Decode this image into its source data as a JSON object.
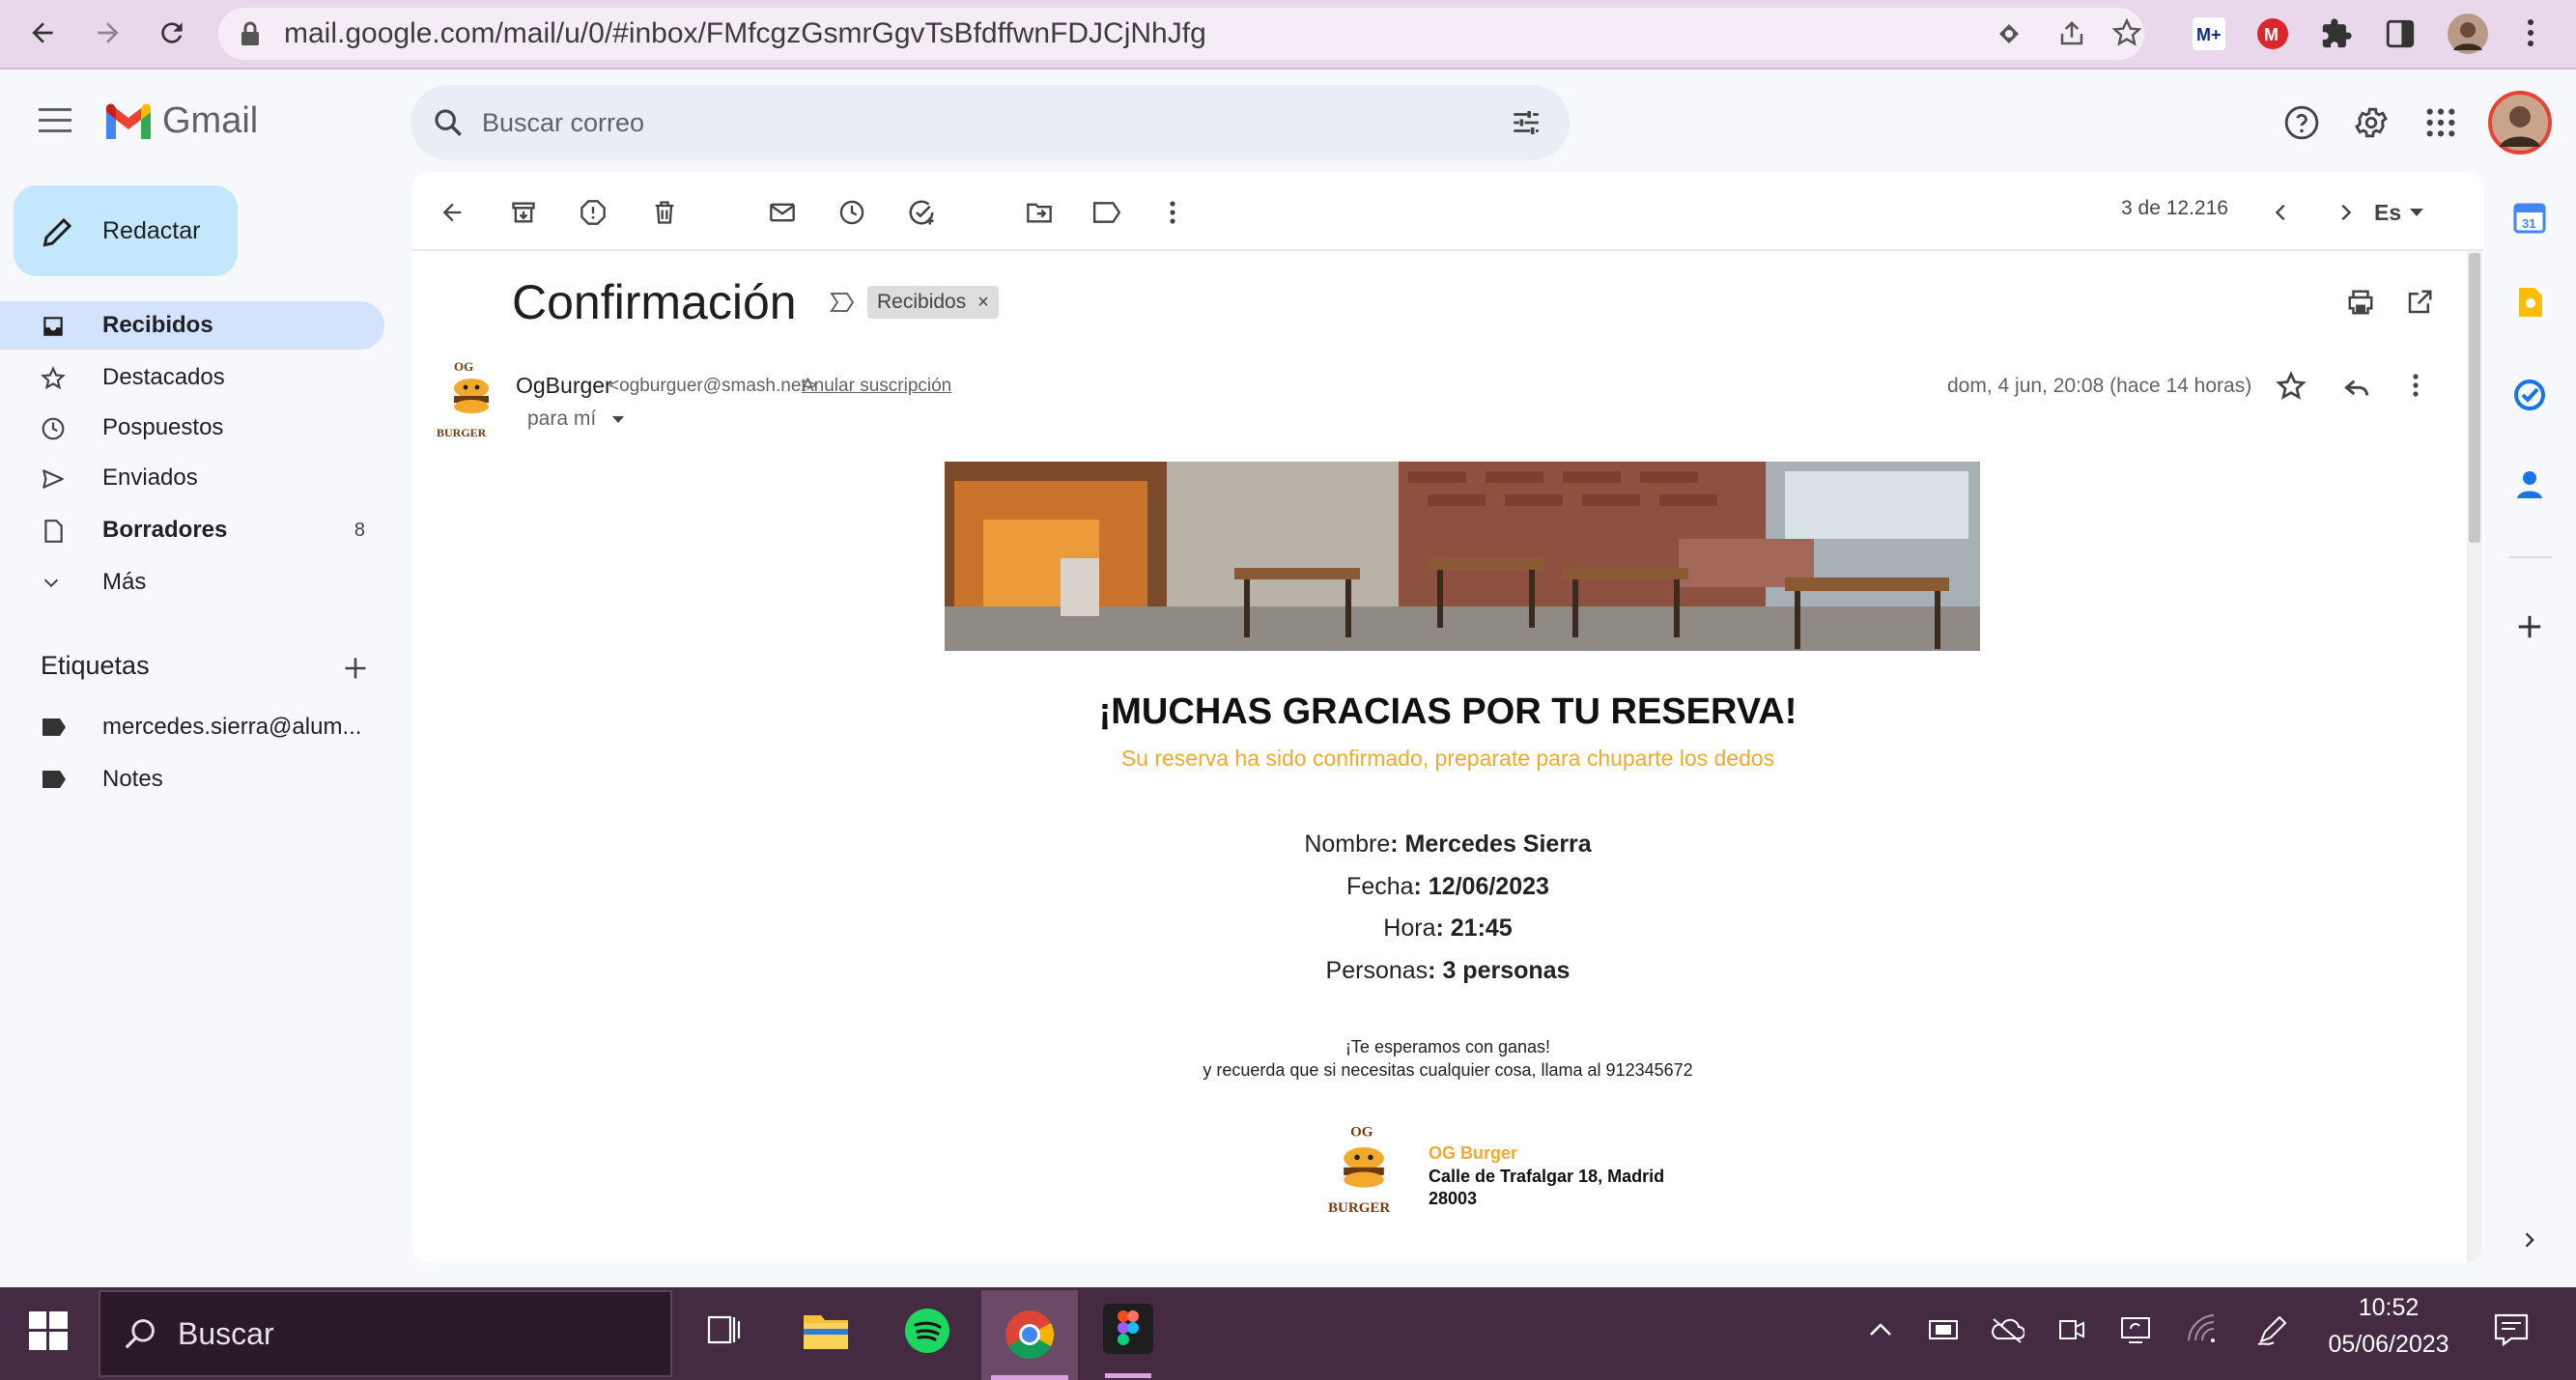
{
  "browser": {
    "url": "mail.google.com/mail/u/0/#inbox/FMfcgzGsmrGgvTsBfdffwnFDJCjNhJfg"
  },
  "gmail": {
    "logo_text": "Gmail",
    "search_placeholder": "Buscar correo"
  },
  "sidebar": {
    "compose_label": "Redactar",
    "items": [
      {
        "label": "Recibidos",
        "icon": "inbox-icon",
        "count": ""
      },
      {
        "label": "Destacados",
        "icon": "star-icon",
        "count": ""
      },
      {
        "label": "Pospuestos",
        "icon": "clock-icon",
        "count": ""
      },
      {
        "label": "Enviados",
        "icon": "send-icon",
        "count": ""
      },
      {
        "label": "Borradores",
        "icon": "draft-icon",
        "count": "8"
      },
      {
        "label": "Más",
        "icon": "chevron-down-icon",
        "count": ""
      }
    ],
    "labels_title": "Etiquetas",
    "labels": [
      {
        "label": "mercedes.sierra@alum..."
      },
      {
        "label": "Notes"
      }
    ]
  },
  "toolbar": {
    "pager": "3 de 12.216",
    "lang": "Es"
  },
  "message": {
    "subject": "Confirmación",
    "chip": "Recibidos",
    "sender_name": "OgBurger",
    "sender_email": "<ogburguer@smash.net>",
    "unsubscribe": "Anular suscripción",
    "to": "para mí",
    "date": "dom, 4 jun, 20:08 (hace 14 horas)"
  },
  "email_body": {
    "thanks": "¡MUCHAS GRACIAS POR TU RESERVA!",
    "subtitle": "Su reserva ha sido confirmado, preparate para chuparte los dedos",
    "name_label": "Nombre",
    "name_value": ": Mercedes Sierra",
    "date_label": "Fecha",
    "date_value": ": 12/06/2023",
    "time_label": "Hora",
    "time_value": ": 21:45",
    "people_label": "Personas",
    "people_value": ": 3 personas",
    "closing1": "¡Te esperamos con ganas!",
    "closing2": "y recuerda que si necesitas cualquier cosa, llama al 912345672",
    "footer_brand": "OG Burger",
    "footer_addr1": "Calle de Trafalgar 18, Madrid",
    "footer_addr2": "28003",
    "logo_text": "OG BURGER"
  },
  "taskbar": {
    "search": "Buscar",
    "time": "10:52",
    "date": "05/06/2023"
  },
  "colors": {
    "accent_orange": "#f3a92b",
    "inbox_selected": "#d3e3fd",
    "compose_bg": "#c2e7ff",
    "browser_bar": "#e9d8ec",
    "taskbar": "#452b42"
  }
}
